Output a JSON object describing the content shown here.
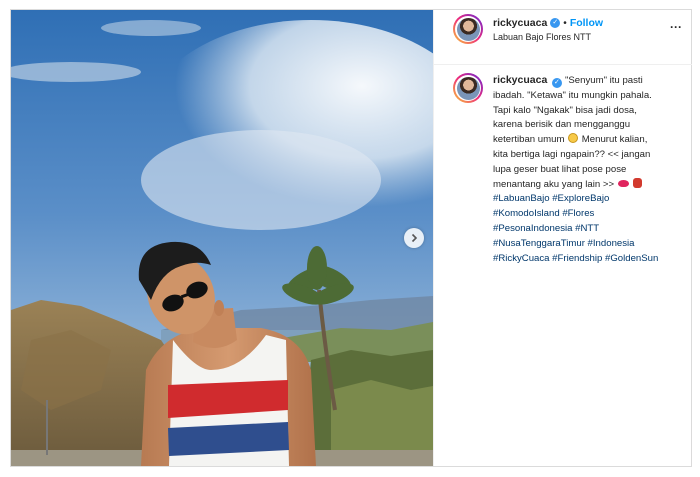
{
  "header": {
    "username": "rickycuaca",
    "separator": "•",
    "follow_label": "Follow",
    "location": "Labuan Bajo Flores NTT",
    "more_label": "···"
  },
  "icons": {
    "verified": "verified-badge-icon",
    "next": "chevron-right-icon",
    "more": "more-options-icon"
  },
  "caption": {
    "username": "rickycuaca",
    "lines": [
      "\"Senyum\" itu pasti",
      "ibadah. \"Ketawa\" itu mungkin pahala.",
      "Tapi kalo \"Ngakak\" bisa jadi dosa,",
      "karena berisik dan mengganggu",
      "ketertiban umum",
      "Menurut kalian,",
      "kita bertiga lagi ngapain?? << jangan",
      "lupa geser buat lihat pose pose",
      "menantang aku yang lain >>"
    ],
    "hashtags": [
      "#LabuanBajo #ExploreBajo",
      "#KomodoIsland #Flores",
      "#PesonaIndonesia #NTT",
      "#NusaTenggaraTimur #Indonesia",
      "#RickyCuaca #Friendship #GoldenSun"
    ]
  },
  "colors": {
    "link": "#0095f6",
    "hashtag": "#00376b",
    "verified": "#3897f0"
  }
}
